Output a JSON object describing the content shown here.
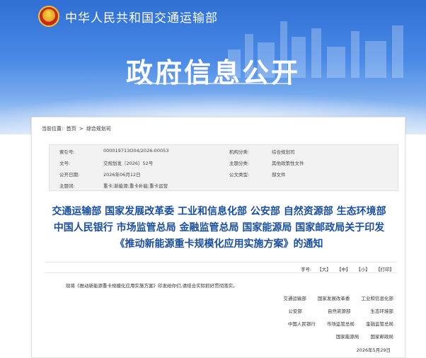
{
  "header": {
    "ministry_name": "中华人民共和国交通运输部",
    "section_title": "政府信息公开"
  },
  "breadcrumb": {
    "label": "当前位置:",
    "items": [
      "首页",
      ">",
      "综合规划司"
    ]
  },
  "meta": {
    "rows": [
      {
        "k1": "索引号:",
        "v1": "000019713O04/2026-00053",
        "k2": "机构分类:",
        "v2": "综合规划司"
      },
      {
        "k1": "文号:",
        "v1": "交规划发〔2026〕52号",
        "k2": "主题分类:",
        "v2": "其他政策性文件"
      },
      {
        "k1": "公开日期:",
        "v1": "2026年06月12日",
        "k2": "公文类型:",
        "v2": "部文件"
      },
      {
        "k1": "主题词:",
        "v1": "重卡;新能源;重卡补能;重卡运营",
        "k2": "",
        "v2": ""
      }
    ]
  },
  "document": {
    "title_lines": [
      "交通运输部 国家发展改革委 工业和信息化部 公安部 自然资源部 生态环境部",
      "中国人民银行 市场监管总局 金融监管总局 国家能源局 国家邮政局关于印发",
      "《推动新能源重卡规模化应用实施方案》的通知"
    ],
    "body": "现将《推动新能源重卡规模化应用实施方案》印发给你们,请结合实际抓好贯彻落实。",
    "signers": [
      [
        "交通运输部",
        "国家发展改革委",
        "工业和信息化部"
      ],
      [
        "公安部",
        "自然资源部",
        "生态环境部"
      ],
      [
        "中国人民银行",
        "市场监管总局",
        "金融监管总局"
      ],
      [
        "国家能源局",
        "国家邮政局"
      ]
    ],
    "date": "2026年5月29日"
  },
  "toolbar": {
    "font_label": "字号:",
    "large": "【大】",
    "medium": "【中】",
    "small": "【小】",
    "print": "【打印】"
  }
}
